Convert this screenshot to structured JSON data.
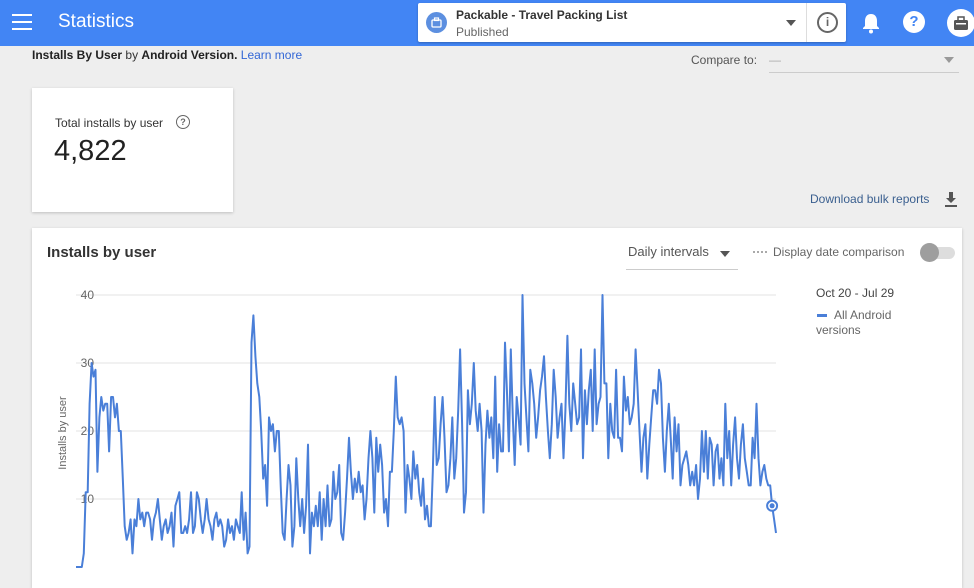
{
  "header": {
    "title": "Statistics",
    "app_name": "Packable - Travel Packing List",
    "app_status": "Published",
    "icons": [
      "menu-icon",
      "info-icon",
      "bell-icon",
      "help-icon",
      "avatar"
    ]
  },
  "subheader": {
    "metric": "Installs By User",
    "by_text": "by",
    "dimension": "Android Version.",
    "learn_more": "Learn more",
    "compare_label": "Compare to:",
    "compare_value": "—"
  },
  "kpi": {
    "label": "Total installs by user",
    "value": "4,822"
  },
  "download_label": "Download bulk reports",
  "chart_card": {
    "title": "Installs by user",
    "interval": "Daily intervals",
    "compare_toggle_label": "Display date comparison",
    "compare_toggle_on": false
  },
  "colors": {
    "appbar": "#4285f4",
    "series": "#4a7fd8"
  },
  "chart_data": {
    "type": "line",
    "title": "",
    "xlabel": "",
    "ylabel": "Installs by user",
    "ylim": [
      0,
      40
    ],
    "yticks": [
      "10",
      "20",
      "30",
      "40"
    ],
    "date_range": "Oct 20 - Jul 29",
    "legend_position": "right",
    "series": [
      {
        "name": "All Android versions",
        "values": [
          0,
          0,
          0,
          0,
          2,
          11,
          11,
          24,
          30,
          28,
          29,
          14,
          22,
          25,
          23,
          24,
          24,
          17,
          25,
          25,
          22,
          24,
          20,
          20,
          13,
          6,
          4,
          5,
          7,
          2,
          7,
          6,
          10,
          7,
          8,
          6,
          8,
          8,
          7,
          4,
          7,
          8,
          10,
          7,
          4,
          6,
          7,
          5,
          6,
          8,
          3,
          9,
          10,
          11,
          5,
          5,
          6,
          5,
          7,
          11,
          5,
          6,
          11,
          10,
          7,
          5,
          7,
          10,
          7,
          6,
          4,
          7,
          8,
          6,
          7,
          6,
          3,
          4,
          7,
          5,
          6,
          4,
          7,
          6,
          5,
          11,
          4,
          8,
          2,
          3,
          33,
          37,
          31,
          27,
          25,
          20,
          13,
          15,
          9,
          22,
          20,
          21,
          17,
          20,
          20,
          12,
          5,
          4,
          10,
          15,
          12,
          3,
          6,
          16,
          10,
          6,
          10,
          5,
          9,
          18,
          2,
          8,
          6,
          9,
          6,
          11,
          4,
          10,
          6,
          12,
          6,
          7,
          14,
          10,
          11,
          15,
          5,
          4,
          8,
          13,
          19,
          14,
          10,
          13,
          11,
          14,
          11,
          12,
          7,
          10,
          16,
          20,
          16,
          8,
          19,
          14,
          18,
          15,
          8,
          10,
          6,
          14,
          14,
          20,
          28,
          22,
          21,
          22,
          20,
          8,
          15,
          13,
          10,
          17,
          13,
          15,
          11,
          9,
          13,
          7,
          9,
          6,
          6,
          14,
          25,
          15,
          16,
          21,
          25,
          19,
          11,
          12,
          16,
          22,
          13,
          16,
          23,
          32,
          21,
          8,
          11,
          26,
          21,
          24,
          30,
          23,
          20,
          24,
          20,
          8,
          18,
          23,
          19,
          22,
          16,
          28,
          14,
          21,
          17,
          17,
          33,
          26,
          17,
          32,
          22,
          15,
          25,
          22,
          18,
          40,
          27,
          22,
          17,
          29,
          27,
          24,
          19,
          22,
          26,
          28,
          31,
          25,
          20,
          16,
          21,
          29,
          25,
          19,
          22,
          24,
          16,
          23,
          34,
          24,
          20,
          27,
          24,
          21,
          22,
          32,
          16,
          26,
          21,
          26,
          29,
          20,
          32,
          21,
          24,
          25,
          40,
          27,
          27,
          16,
          24,
          20,
          19,
          29,
          19,
          19,
          17,
          28,
          23,
          25,
          21,
          22,
          24,
          32,
          26,
          20,
          14,
          19,
          21,
          13,
          18,
          22,
          26,
          26,
          24,
          29,
          27,
          19,
          14,
          20,
          24,
          19,
          13,
          22,
          17,
          21,
          12,
          15,
          16,
          17,
          15,
          12,
          14,
          12,
          15,
          10,
          13,
          20,
          14,
          20,
          13,
          19,
          18,
          12,
          17,
          18,
          13,
          16,
          12,
          24,
          16,
          20,
          12,
          18,
          22,
          16,
          13,
          18,
          21,
          16,
          14,
          12,
          12,
          19,
          16,
          24,
          16,
          12,
          14,
          15,
          13,
          12,
          12,
          9,
          7,
          5
        ]
      }
    ]
  }
}
